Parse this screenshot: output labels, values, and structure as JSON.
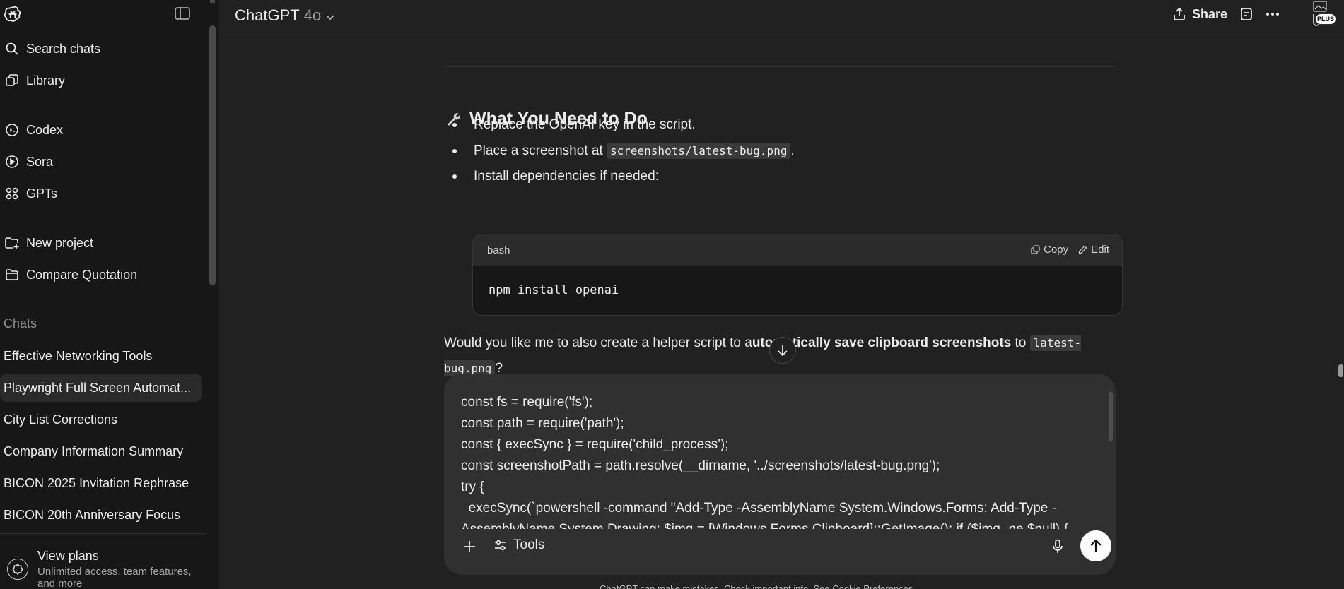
{
  "sidebar": {
    "top_items": [
      {
        "label": "Search chats",
        "icon": "search-icon"
      },
      {
        "label": "Library",
        "icon": "library-icon"
      },
      {
        "label": "Codex",
        "icon": "codex-icon"
      },
      {
        "label": "Sora",
        "icon": "sora-icon"
      },
      {
        "label": "GPTs",
        "icon": "gpts-icon"
      },
      {
        "label": "New project",
        "icon": "new-project-icon"
      },
      {
        "label": "Compare Quotation",
        "icon": "folder-icon"
      }
    ],
    "section_label": "Chats",
    "chats": [
      "Effective Networking Tools",
      "Playwright Full Screen Automat...",
      "City List Corrections",
      "Company Information Summary",
      "BICON 2025 Invitation Rephrase",
      "BICON 20th Anniversary Focus"
    ],
    "plans": {
      "title": "View plans",
      "subtitle": "Unlimited access, team features, and more"
    }
  },
  "header": {
    "model_name": "ChatGPT",
    "model_version": "4o",
    "share_label": "Share",
    "plus_badge": "PLUS"
  },
  "message": {
    "heading": "What You Need to Do",
    "bullet1": "Replace the OpenAI key in the script.",
    "bullet2_prefix": "Place a screenshot at",
    "bullet2_code": "screenshots/latest-bug.png",
    "bullet2_suffix": ".",
    "bullet3": "Install dependencies if needed:",
    "code_lang": "bash",
    "copy_label": "Copy",
    "edit_label": "Edit",
    "code": "npm install openai",
    "para_prefix": "Would you like me to also create a helper script to a",
    "para_bold": "utomatically save clipboard screenshots",
    "para_mid": " to ",
    "para_code": "latest-bug.png",
    "para_suffix": "?"
  },
  "composer": {
    "text": "const fs = require('fs');\nconst path = require('path');\nconst { execSync } = require('child_process');\nconst screenshotPath = path.resolve(__dirname, '../screenshots/latest-bug.png');\ntry {\n  execSync(`powershell -command \"Add-Type -AssemblyName System.Windows.Forms; Add-Type -AssemblyName System.Drawing; $img = [Windows.Forms.Clipboard]::GetImage(); if ($img -ne $null) {",
    "tools_label": "Tools"
  },
  "footnote": "ChatGPT can make mistakes. Check important info. See Cookie Preferences."
}
